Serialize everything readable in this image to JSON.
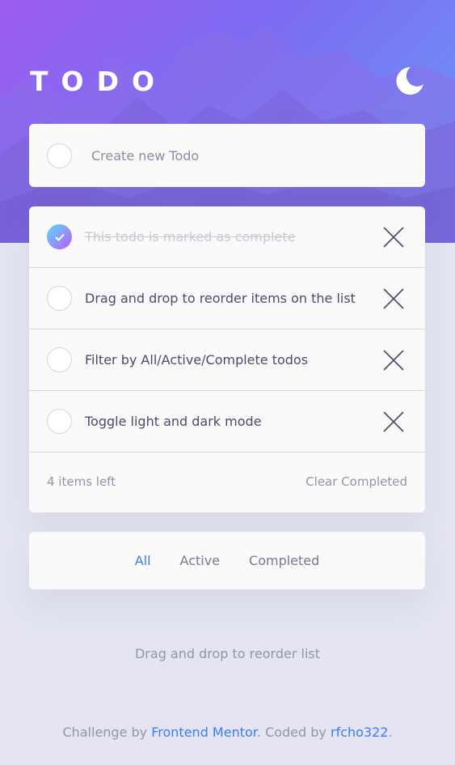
{
  "header": {
    "title": "TODO",
    "theme_icon": "moon-icon"
  },
  "new_todo": {
    "placeholder": "Create new Todo",
    "value": ""
  },
  "todos": [
    {
      "text": "This todo is marked as complete",
      "completed": true
    },
    {
      "text": "Drag and drop to reorder items on the list",
      "completed": false
    },
    {
      "text": "Filter by All/Active/Complete todos",
      "completed": false
    },
    {
      "text": "Toggle light and dark mode",
      "completed": false
    }
  ],
  "list_footer": {
    "items_left": "4 items left",
    "clear_label": "Clear Completed"
  },
  "filters": {
    "all": "All",
    "active": "Active",
    "completed": "Completed",
    "selected": "All"
  },
  "hint": "Drag and drop to reorder list",
  "attribution": {
    "prefix": "Challenge by ",
    "link1": "Frontend Mentor",
    "middle": ". Coded by ",
    "link2": "rfcho322",
    "suffix": "."
  },
  "colors": {
    "accent": "#3a7bfd",
    "check_gradient_start": "#57ddff",
    "check_gradient_end": "#c058f3",
    "page_bg": "#e4e5f1",
    "card_bg": "#fafafa"
  }
}
